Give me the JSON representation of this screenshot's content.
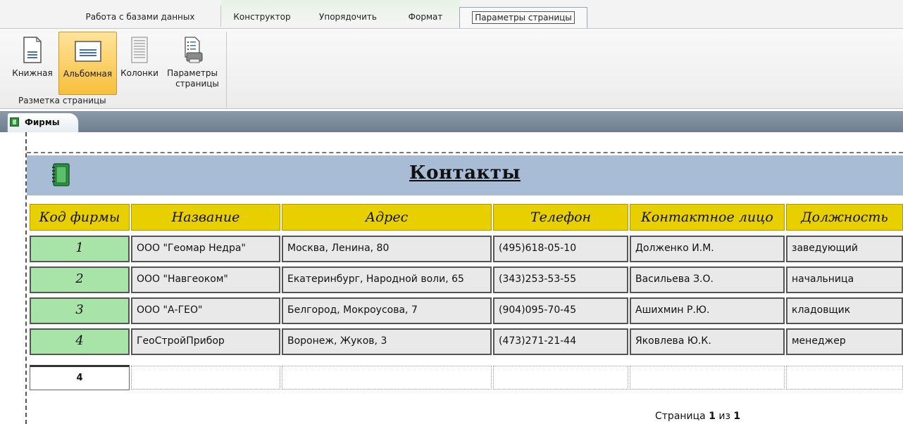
{
  "ribbon": {
    "tabs": [
      "Работа с базами данных",
      "Конструктор",
      "Упорядочить",
      "Формат",
      "Параметры страницы"
    ],
    "buttons": {
      "portrait": "Книжная",
      "landscape": "Альбомная",
      "columns": "Колонки",
      "page_setup_line1": "Параметры",
      "page_setup_line2": "страницы"
    },
    "group_label": "Разметка страницы"
  },
  "document": {
    "tab_label": "Фирмы"
  },
  "report": {
    "title": "Контакты",
    "columns": [
      "Код фирмы",
      "Название",
      "Адрес",
      "Телефон",
      "Контактное лицо",
      "Должность"
    ],
    "rows": [
      {
        "id": "1",
        "name": "ООО \"Геомар Недра\"",
        "address": "Москва, Ленина, 80",
        "phone": "(495)618-05-10",
        "contact": "Долженко И.М.",
        "position": "заведующий"
      },
      {
        "id": "2",
        "name": "ООО \"Навгеоком\"",
        "address": "Екатеринбург, Народной воли, 65",
        "phone": "(343)253-53-55",
        "contact": "Васильева З.О.",
        "position": "начальница"
      },
      {
        "id": "3",
        "name": "ООО \"А-ГЕО\"",
        "address": "Белгород, Мокроусова, 7",
        "phone": "(904)095-70-45",
        "contact": "Ашихмин Р.Ю.",
        "position": "кладовщик"
      },
      {
        "id": "4",
        "name": "ГеоСтройПрибор",
        "address": "Воронеж, Жуков, 3",
        "phone": "(473)271-21-44",
        "contact": "Яковлева Ю.К.",
        "position": "менеджер"
      }
    ],
    "record_count": "4",
    "page_indicator_prefix": "Страница ",
    "page_current": "1",
    "page_indicator_mid": " из ",
    "page_total": "1"
  },
  "colors": {
    "header_band": "#a8bcd6",
    "column_header": "#e8d000",
    "id_cell": "#a8e4a8",
    "selected_button": "#f7bf3c"
  }
}
